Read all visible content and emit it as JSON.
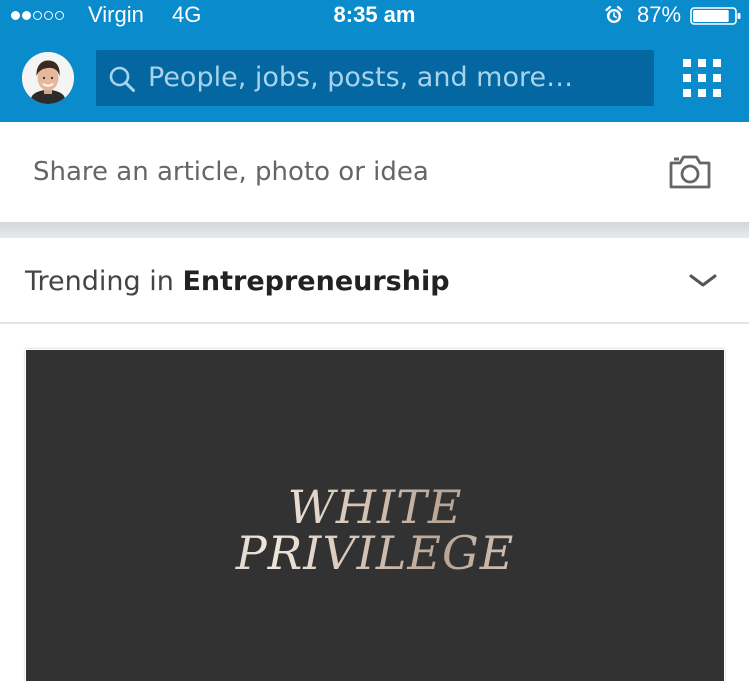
{
  "status_bar": {
    "carrier": "Virgin",
    "network": "4G",
    "time": "8:35 am",
    "battery_percent": "87%",
    "battery_level": 0.87,
    "signal_bars_filled": 2,
    "signal_bars_total": 5,
    "icons": [
      "alarm-icon",
      "battery-icon"
    ]
  },
  "header": {
    "avatar": "avatar",
    "search_placeholder": "People, jobs, posts, and more…",
    "icons": [
      "search-icon",
      "apps-grid-icon"
    ]
  },
  "share": {
    "prompt": "Share an article, photo or idea",
    "icon": "camera-icon"
  },
  "trending": {
    "prefix": "Trending in",
    "topic": "Entrepreneurship",
    "icon": "chevron-down-icon"
  },
  "article": {
    "image_title_line1": "WHITE",
    "image_title_line2": "PRIVILEGE"
  },
  "colors": {
    "brand_blue": "#0a8bcc",
    "search_field": "#0467a1",
    "card_image_bg": "#323232"
  }
}
